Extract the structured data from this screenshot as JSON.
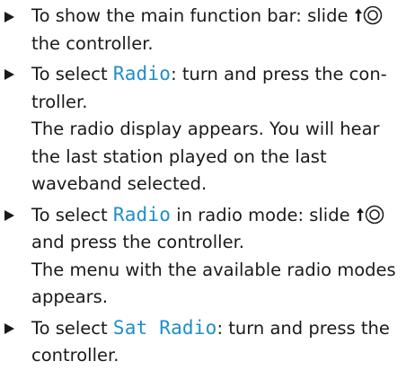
{
  "colors": {
    "keyword": "#1f8ec9",
    "text": "#1a1a1a",
    "bullet": "#1a1a1a"
  },
  "icons": {
    "bullet": "triangle-right-bullet",
    "controller": "controller-slide-up-icon"
  },
  "steps": [
    {
      "part1": "To show the main function bar: slide ",
      "part2": "the controller."
    },
    {
      "part1": "To select ",
      "keyword": "Radio",
      "part2": ": turn and press the con-troller.",
      "result": "The radio display appears. You will hear the last station played on the last waveband selected."
    },
    {
      "part1": "To select ",
      "keyword": "Radio",
      "part2": " in radio mode: slide ",
      "part3": "and press the controller.",
      "result": "The menu with the available radio modes appears."
    },
    {
      "part1": "To select ",
      "keyword": "Sat Radio",
      "part2": ": turn and press the controller."
    }
  ]
}
